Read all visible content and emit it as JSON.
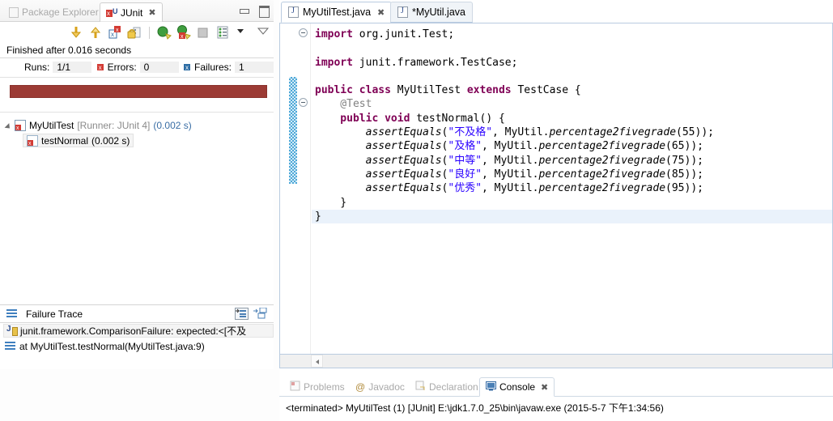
{
  "left_view": {
    "tabs": [
      {
        "label": "Package Explorer",
        "icon": "package-explorer-icon",
        "active": false,
        "closable": false
      },
      {
        "label": "JUnit",
        "icon": "junit-icon",
        "active": true,
        "closable": true
      }
    ],
    "window_buttons": [
      {
        "name": "minimize",
        "icon": "minimize-icon"
      },
      {
        "name": "maximize",
        "icon": "maximize-icon"
      }
    ],
    "toolbar": [
      {
        "name": "next-failed-test",
        "icon": "arrow-down-icon"
      },
      {
        "name": "previous-failed-test",
        "icon": "arrow-up-icon"
      },
      {
        "name": "show-failures-only",
        "icon": "failures-filter-icon"
      },
      {
        "name": "scroll-lock",
        "icon": "lock-icon"
      },
      {
        "name": "rerun-test",
        "icon": "rerun-icon"
      },
      {
        "name": "rerun-failed-tests",
        "icon": "rerun-failed-icon"
      },
      {
        "name": "stop-test-run",
        "icon": "stop-icon"
      },
      {
        "name": "test-run-history",
        "icon": "history-icon"
      },
      {
        "name": "view-menu",
        "icon": "chevron-down-icon"
      },
      {
        "name": "minimize-view",
        "icon": "minimize-view-icon"
      }
    ],
    "status": "Finished after 0.016 seconds",
    "counters": {
      "runs_label": "Runs:",
      "runs_value": "1/1",
      "errors_label": "Errors:",
      "errors_value": "0",
      "failures_label": "Failures:",
      "failures_value": "1"
    },
    "progress_color": "#9c3b35",
    "tree": [
      {
        "name": "MyUtilTest",
        "runner": "[Runner: JUnit 4]",
        "time": "(0.002 s)",
        "level": 0,
        "expanded": true,
        "selected": false
      },
      {
        "name": "testNormal",
        "runner": "",
        "time": "(0.002 s)",
        "level": 1,
        "expanded": false,
        "selected": true
      }
    ],
    "failure_trace": {
      "title": "Failure Trace",
      "tools": [
        {
          "name": "filter-stack-trace",
          "icon": "filter-icon"
        },
        {
          "name": "compare-result",
          "icon": "compare-icon"
        }
      ],
      "lines": [
        {
          "text": "junit.framework.ComparisonFailure: expected:<[不及",
          "icon": "exception-icon",
          "selected": true
        },
        {
          "text": "at MyUtilTest.testNormal(MyUtilTest.java:9)",
          "icon": "stack-frame-icon",
          "selected": false
        }
      ]
    }
  },
  "editor": {
    "tabs": [
      {
        "label": "MyUtilTest.java",
        "icon": "java-file-icon",
        "active": true,
        "dirty": false,
        "closable": true
      },
      {
        "label": "*MyUtil.java",
        "icon": "java-file-icon",
        "active": false,
        "dirty": true,
        "closable": false
      }
    ],
    "code_lines": [
      {
        "highlight": false,
        "fold": true,
        "tokens": [
          {
            "t": "kw",
            "v": "import"
          },
          {
            "t": "plain",
            "v": " org.junit.Test;"
          }
        ]
      },
      {
        "highlight": false,
        "fold": false,
        "tokens": []
      },
      {
        "highlight": false,
        "fold": false,
        "tokens": [
          {
            "t": "kw",
            "v": "import"
          },
          {
            "t": "plain",
            "v": " junit.framework.TestCase;"
          }
        ]
      },
      {
        "highlight": false,
        "fold": false,
        "tokens": []
      },
      {
        "highlight": false,
        "fold": false,
        "tokens": [
          {
            "t": "kw",
            "v": "public class"
          },
          {
            "t": "plain",
            "v": " MyUtilTest "
          },
          {
            "t": "kw",
            "v": "extends"
          },
          {
            "t": "plain",
            "v": " TestCase {"
          }
        ]
      },
      {
        "highlight": false,
        "fold": true,
        "tokens": [
          {
            "t": "ann",
            "v": "    @Test"
          }
        ]
      },
      {
        "highlight": false,
        "fold": false,
        "tokens": [
          {
            "t": "kw",
            "v": "    public void"
          },
          {
            "t": "plain",
            "v": " testNormal() {"
          }
        ]
      },
      {
        "highlight": false,
        "fold": false,
        "tokens": [
          {
            "t": "mth",
            "v": "        assertEquals"
          },
          {
            "t": "plain",
            "v": "("
          },
          {
            "t": "str",
            "v": "\"不及格\""
          },
          {
            "t": "plain",
            "v": ", MyUtil."
          },
          {
            "t": "mth",
            "v": "percentage2fivegrade"
          },
          {
            "t": "plain",
            "v": "(55));"
          }
        ]
      },
      {
        "highlight": false,
        "fold": false,
        "tokens": [
          {
            "t": "mth",
            "v": "        assertEquals"
          },
          {
            "t": "plain",
            "v": "("
          },
          {
            "t": "str",
            "v": "\"及格\""
          },
          {
            "t": "plain",
            "v": ", MyUtil."
          },
          {
            "t": "mth",
            "v": "percentage2fivegrade"
          },
          {
            "t": "plain",
            "v": "(65));"
          }
        ]
      },
      {
        "highlight": false,
        "fold": false,
        "tokens": [
          {
            "t": "mth",
            "v": "        assertEquals"
          },
          {
            "t": "plain",
            "v": "("
          },
          {
            "t": "str",
            "v": "\"中等\""
          },
          {
            "t": "plain",
            "v": ", MyUtil."
          },
          {
            "t": "mth",
            "v": "percentage2fivegrade"
          },
          {
            "t": "plain",
            "v": "(75));"
          }
        ]
      },
      {
        "highlight": false,
        "fold": false,
        "tokens": [
          {
            "t": "mth",
            "v": "        assertEquals"
          },
          {
            "t": "plain",
            "v": "("
          },
          {
            "t": "str",
            "v": "\"良好\""
          },
          {
            "t": "plain",
            "v": ", MyUtil."
          },
          {
            "t": "mth",
            "v": "percentage2fivegrade"
          },
          {
            "t": "plain",
            "v": "(85));"
          }
        ]
      },
      {
        "highlight": false,
        "fold": false,
        "tokens": [
          {
            "t": "mth",
            "v": "        assertEquals"
          },
          {
            "t": "plain",
            "v": "("
          },
          {
            "t": "str",
            "v": "\"优秀\""
          },
          {
            "t": "plain",
            "v": ", MyUtil."
          },
          {
            "t": "mth",
            "v": "percentage2fivegrade"
          },
          {
            "t": "plain",
            "v": "(95));"
          }
        ]
      },
      {
        "highlight": false,
        "fold": false,
        "tokens": [
          {
            "t": "plain",
            "v": "    }"
          }
        ]
      },
      {
        "highlight": true,
        "fold": false,
        "tokens": [
          {
            "t": "plain",
            "v": "}"
          }
        ]
      }
    ],
    "scrollbar": {
      "name": "horizontal-scrollbar",
      "left_arrow": "arrow-left-icon"
    }
  },
  "console": {
    "tabs": [
      {
        "label": "Problems",
        "icon": "problems-icon",
        "active": false,
        "closable": false
      },
      {
        "label": "Javadoc",
        "icon": "javadoc-icon",
        "active": false,
        "closable": false
      },
      {
        "label": "Declaration",
        "icon": "declaration-icon",
        "active": false,
        "closable": false
      },
      {
        "label": "Console",
        "icon": "console-icon",
        "active": true,
        "closable": true
      }
    ],
    "output": "<terminated> MyUtilTest (1) [JUnit] E:\\jdk1.7.0_25\\bin\\javaw.exe (2015-5-7 下午1:34:56)"
  }
}
